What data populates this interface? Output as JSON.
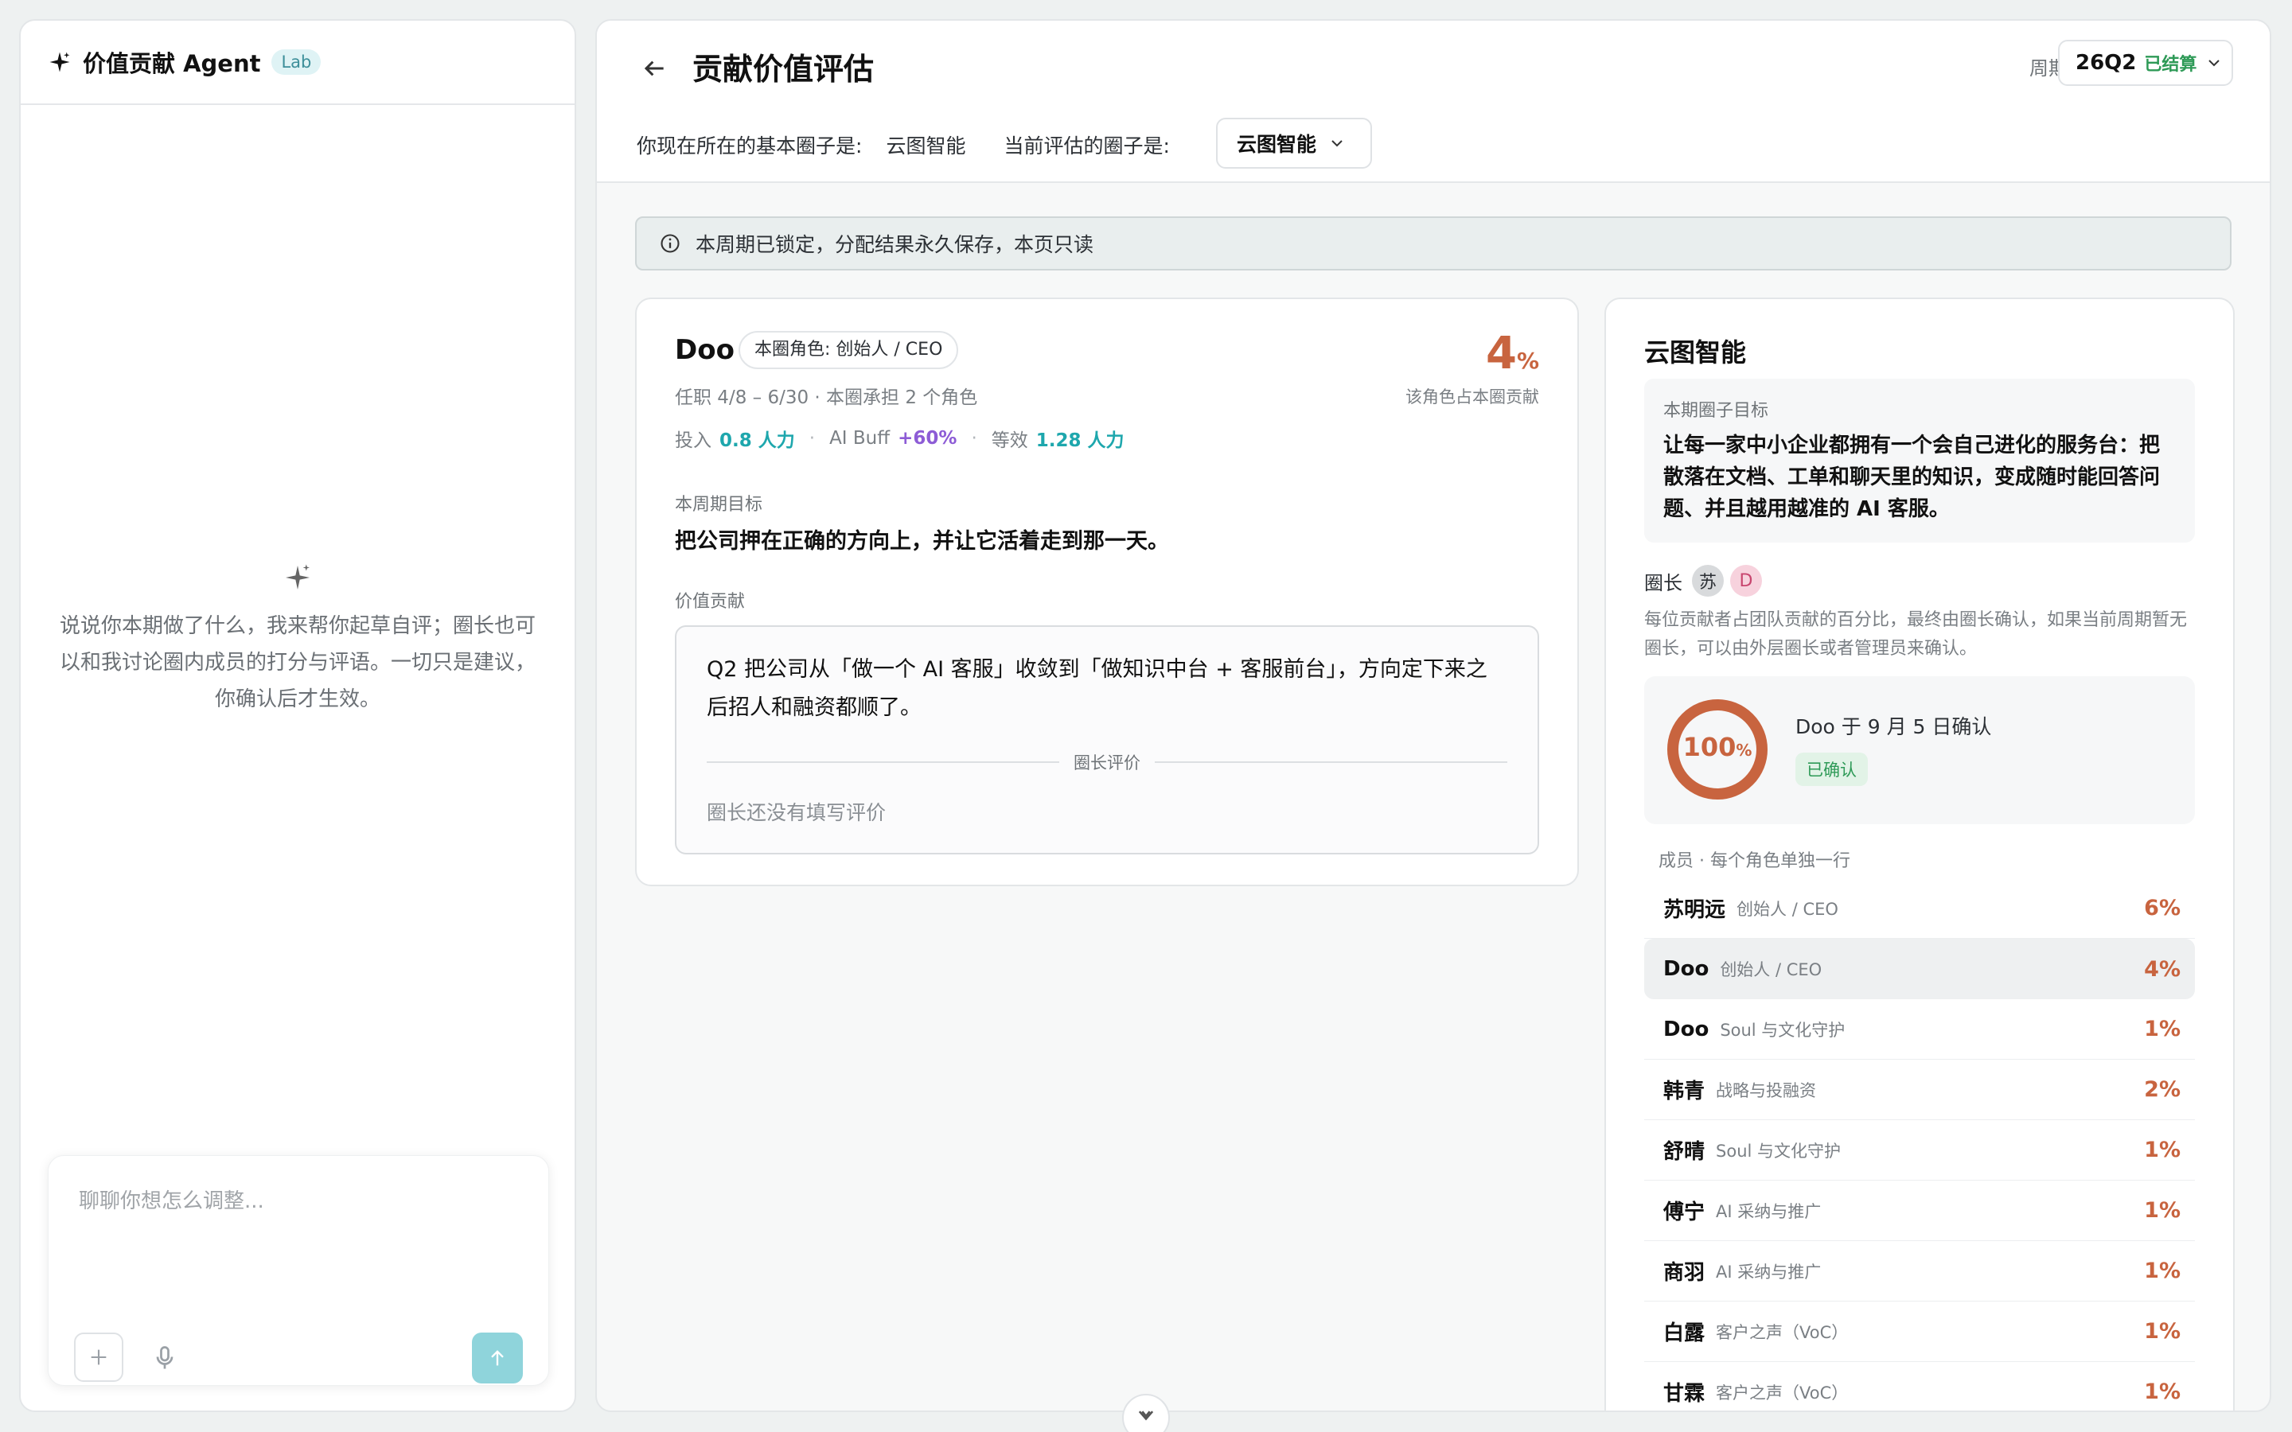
{
  "agent": {
    "title": "价值贡献 Agent",
    "badge": "Lab",
    "hint": "说说你本期做了什么，我来帮你起草自评；圈长也可以和我讨论圈内成员的打分与评语。一切只是建议，你确认后才生效。",
    "input_placeholder": "聊聊你想怎么调整...",
    "icons": {
      "header": "sparkle-icon",
      "hint": "sparkle-icon",
      "attach": "plus-icon",
      "voice": "microphone-icon",
      "send": "arrow-up-icon"
    }
  },
  "header": {
    "title": "贡献价值评估",
    "period_label": "周期",
    "period_value": "26Q2",
    "period_status": "已结算",
    "base_circle_label": "你现在所在的基本圈子是:",
    "base_circle_value": "云图智能",
    "eval_circle_label": "当前评估的圈子是:",
    "eval_circle_value": "云图智能"
  },
  "banner": {
    "text": "本周期已锁定，分配结果永久保存，本页只读"
  },
  "member_card": {
    "name": "Doo",
    "role_badge": "本圈角色: 创始人 / CEO",
    "percent": "4",
    "percent_symbol": "%",
    "percent_label": "该角色占本圈贡献",
    "tenure": "任职 4/8 – 6/30 · 本圈承担 2 个角色",
    "input_label": "投入",
    "input_value": "0.8 人力",
    "ai_buff_label": "AI Buff",
    "ai_buff_value": "+60%",
    "equiv_label": "等效",
    "equiv_value": "1.28 人力",
    "goal_label": "本周期目标",
    "goal_text": "把公司押在正确的方向上，并让它活着走到那一天。",
    "value_label": "价值贡献",
    "value_text": "Q2 把公司从「做一个 AI 客服」收敛到「做知识中台 + 客服前台」，方向定下来之后招人和融资都顺了。",
    "eval_divider_label": "圈长评价",
    "eval_empty": "圈长还没有填写评价"
  },
  "circle_card": {
    "title": "云图智能",
    "goal_label": "本期圈子目标",
    "goal_text": "让每一家中小企业都拥有一个会自己进化的服务台：把散落在文档、工单和聊天里的知识，变成随时能回答问题、并且越用越准的 AI 客服。",
    "leader_label": "圈长",
    "leader_avatars": [
      "苏",
      "D"
    ],
    "note": "每位贡献者占团队贡献的百分比，最终由圈长确认，如果当前周期暂无圈长，可以由外层圈长或者管理员来确认。",
    "donut_value": 100,
    "donut_value_text": "100",
    "donut_symbol": "%",
    "confirmed_by": "Doo 于 9 月 5 日确认",
    "confirmed_badge": "已确认",
    "member_header": "成员 · 每个角色单独一行",
    "members": [
      {
        "name": "苏明远",
        "role": "创始人 / CEO",
        "pct": "6%"
      },
      {
        "name": "Doo",
        "role": "创始人 / CEO",
        "pct": "4%"
      },
      {
        "name": "Doo",
        "role": "Soul 与文化守护",
        "pct": "1%"
      },
      {
        "name": "韩青",
        "role": "战略与投融资",
        "pct": "2%"
      },
      {
        "name": "舒晴",
        "role": "Soul 与文化守护",
        "pct": "1%"
      },
      {
        "name": "傅宁",
        "role": "AI 采纳与推广",
        "pct": "1%"
      },
      {
        "name": "商羽",
        "role": "AI 采纳与推广",
        "pct": "1%"
      },
      {
        "name": "白露",
        "role": "客户之声（VoC）",
        "pct": "1%"
      },
      {
        "name": "甘霖",
        "role": "客户之声（VoC）",
        "pct": "1%"
      }
    ],
    "active_index": 1
  },
  "colors": {
    "accent": "#c8643f",
    "teal": "#1ea7ad",
    "purple": "#8d5cd6",
    "success": "#2e9a57",
    "send_button": "#8fd4db"
  }
}
